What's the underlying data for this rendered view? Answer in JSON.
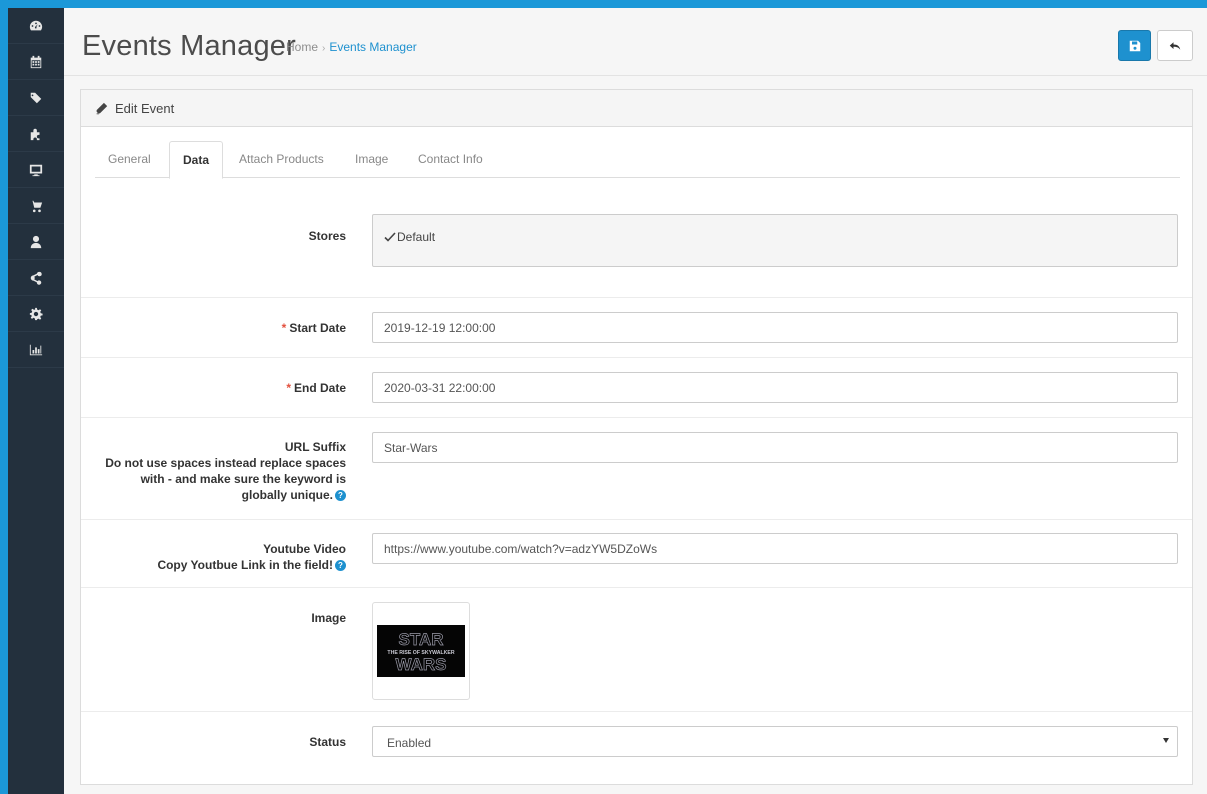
{
  "sidebar": {
    "items": [
      {
        "icon": "dashboard-icon"
      },
      {
        "icon": "calendar-icon"
      },
      {
        "icon": "tags-icon"
      },
      {
        "icon": "puzzle-icon"
      },
      {
        "icon": "desktop-icon"
      },
      {
        "icon": "cart-icon"
      },
      {
        "icon": "user-icon"
      },
      {
        "icon": "share-icon"
      },
      {
        "icon": "cog-icon"
      },
      {
        "icon": "bar-chart-icon"
      }
    ]
  },
  "header": {
    "title": "Events Manager",
    "breadcrumb": {
      "home": "Home",
      "separator": "›",
      "current": "Events Manager"
    },
    "save_icon": "floppy-disk-icon",
    "back_icon": "reply-icon"
  },
  "panel": {
    "heading": "Edit Event",
    "heading_icon": "pencil-icon"
  },
  "tabs": [
    {
      "label": "General",
      "active": false
    },
    {
      "label": "Data",
      "active": true
    },
    {
      "label": "Attach Products",
      "active": false
    },
    {
      "label": "Image",
      "active": false
    },
    {
      "label": "Contact Info",
      "active": false
    }
  ],
  "form": {
    "stores": {
      "label": "Stores",
      "option_label": "Default",
      "checked": true
    },
    "start_date": {
      "required_mark": "*",
      "label": "Start Date",
      "value": "2019-12-19 12:00:00"
    },
    "end_date": {
      "required_mark": "*",
      "label": "End Date",
      "value": "2020-03-31 22:00:00"
    },
    "url_suffix": {
      "label": "URL Suffix",
      "help_line1": "Do not use spaces instead replace spaces",
      "help_line2": "with - and make sure the keyword is",
      "help_line3": "globally unique.",
      "value": "Star-Wars"
    },
    "youtube": {
      "label": "Youtube Video",
      "help": "Copy Youtbue Link in the field!",
      "value": "https://www.youtube.com/watch?v=adzYW5DZoWs"
    },
    "image": {
      "label": "Image",
      "logo_line1": "STAR",
      "logo_subtitle": "THE RISE OF SKYWALKER",
      "logo_line2": "WARS"
    },
    "status": {
      "label": "Status",
      "value": "Enabled"
    }
  },
  "colors": {
    "accent": "#1e91cf",
    "sidebar_bg": "#23303d",
    "required": "#e3503e"
  }
}
